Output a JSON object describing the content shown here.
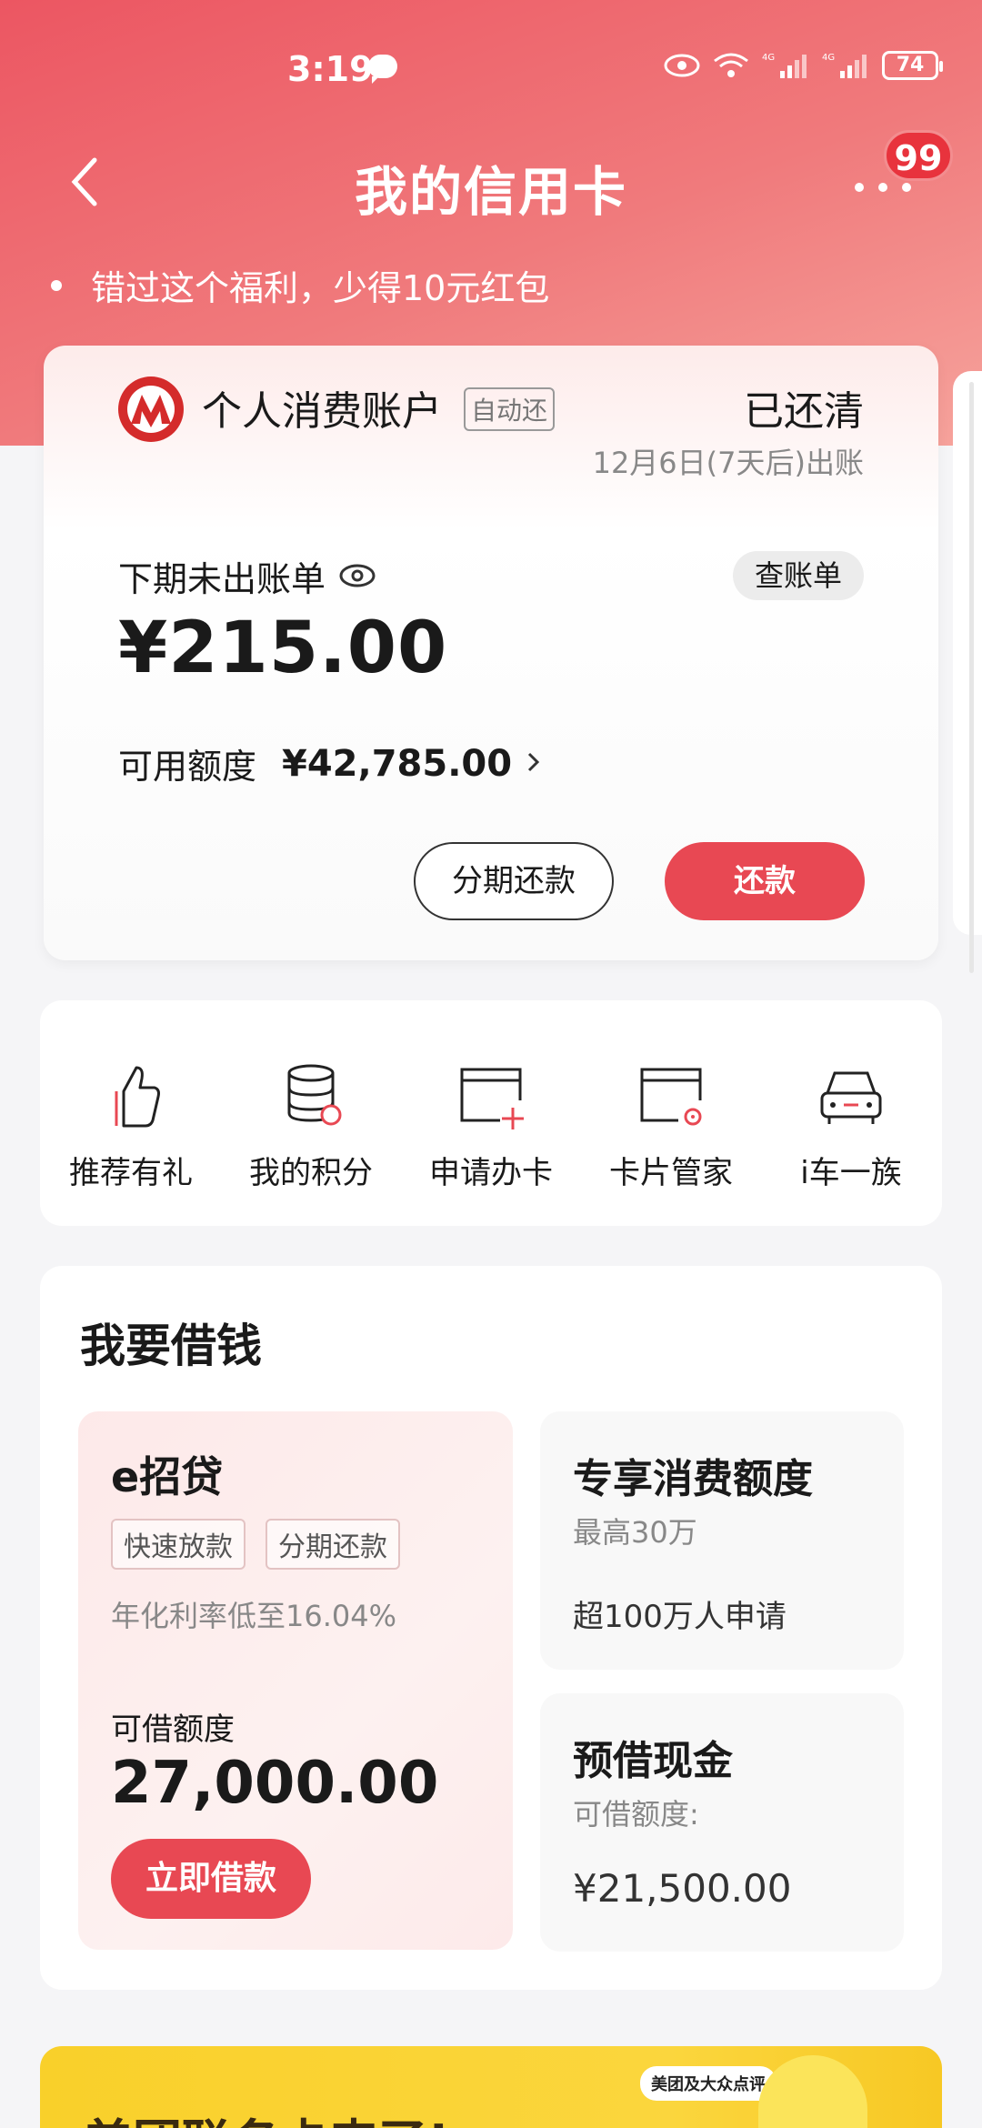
{
  "status_bar": {
    "time": "3:19",
    "battery": "74"
  },
  "nav": {
    "title": "我的信用卡",
    "badge": "99"
  },
  "promo": {
    "text": "错过这个福利，少得10元红包"
  },
  "account": {
    "name": "个人消费账户",
    "auto_tag": "自动还",
    "status": "已还清",
    "bill_date": "12月6日(7天后)出账",
    "bill_label": "下期未出账单",
    "bill_amount": "¥215.00",
    "view_bill_button": "查账单",
    "limit_label": "可用额度",
    "limit_value": "¥42,785.00",
    "installment_button": "分期还款",
    "repay_button": "还款"
  },
  "quick_actions": [
    {
      "label": "推荐有礼",
      "icon": "thumbs-up-icon"
    },
    {
      "label": "我的积分",
      "icon": "points-coins-icon"
    },
    {
      "label": "申请办卡",
      "icon": "apply-card-icon"
    },
    {
      "label": "卡片管家",
      "icon": "card-manager-icon"
    },
    {
      "label": "i车一族",
      "icon": "car-icon"
    }
  ],
  "borrow": {
    "title": "我要借钱",
    "loan": {
      "name": "e招贷",
      "tags": [
        "快速放款",
        "分期还款"
      ],
      "rate": "年化利率低至16.04%",
      "limit_label": "可借额度",
      "limit_value": "27,000.00",
      "button": "立即借款"
    },
    "exclusive": {
      "title": "专享消费额度",
      "sub": "最高30万",
      "foot": "超100万人申请"
    },
    "cash": {
      "title": "预借现金",
      "limit_label": "可借额度:",
      "limit_value": "¥21,500.00"
    }
  },
  "banner": {
    "title": "美团联名卡来了!",
    "tag": "美团及大众点评"
  },
  "colors": {
    "brand_red": "#e84853",
    "header_gradient_start": "#ec5662",
    "banner_yellow": "#f9d02a"
  }
}
